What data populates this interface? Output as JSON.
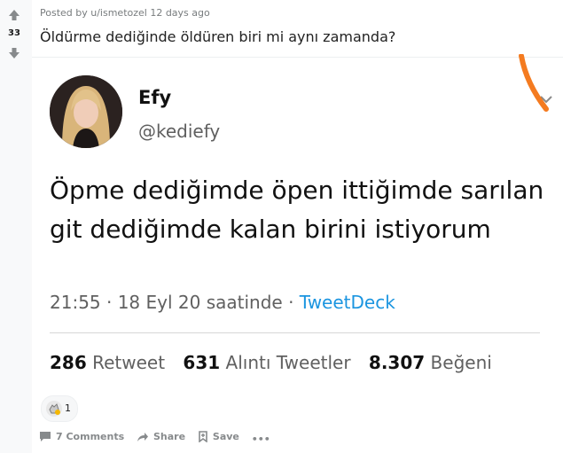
{
  "vote": {
    "score": "33"
  },
  "post": {
    "meta": "Posted by u/ismetozel 12 days ago",
    "title": "Öldürme dediğinde öldüren biri mi aynı zamanda?"
  },
  "tweet": {
    "name": "Efy",
    "handle": "@kediefy",
    "text": "Öpme dediğimde öpen ittiğimde sarılan git dediğimde kalan birini istiyorum",
    "time": "21:55 · 18 Eyl 20 saatinde · ",
    "client": "TweetDeck",
    "retweet_count": "286",
    "retweet_label": "Retweet",
    "quote_count": "631",
    "quote_label": "Alıntı Tweetler",
    "like_count": "8.307",
    "like_label": "Beğeni"
  },
  "awards": {
    "count": "1"
  },
  "actions": {
    "comments": "7 Comments",
    "share": "Share",
    "save": "Save",
    "more": "•••"
  },
  "colors": {
    "accent_blue": "#1b95e0",
    "highlight_orange": "#f47b20",
    "upvote_gray": "#878a8c"
  }
}
